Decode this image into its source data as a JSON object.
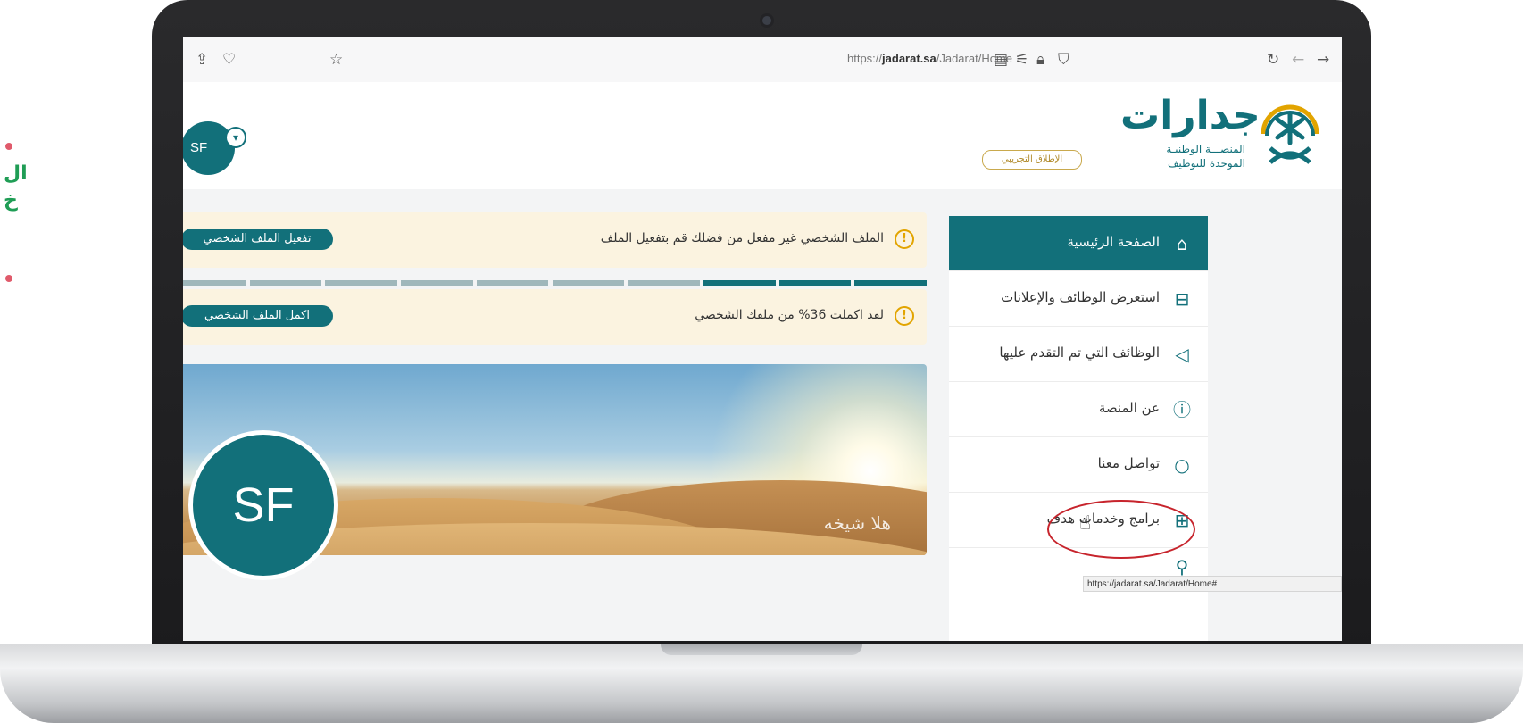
{
  "side_caption": {
    "line1": "ال",
    "line2": "خ"
  },
  "browser": {
    "url_prefix": "https://",
    "url_domain": "jadarat.sa",
    "url_path": "/Jadarat/Home"
  },
  "header": {
    "logo_title": "جدارات",
    "logo_subtitle_1": "المنصـــة الوطنيـة",
    "logo_subtitle_2": "الموحدة للتوظيف",
    "beta_label": "الإطلاق التجريبي",
    "user_initials": "SF"
  },
  "sidebar": {
    "items": [
      {
        "label": "الصفحة الرئيسية",
        "icon": "home-icon"
      },
      {
        "label": "استعرض الوظائف والإعلانات",
        "icon": "briefcase-icon"
      },
      {
        "label": "الوظائف التي تم التقدم عليها",
        "icon": "send-icon"
      },
      {
        "label": "عن المنصة",
        "icon": "info-icon"
      },
      {
        "label": "تواصل معنا",
        "icon": "chat-icon"
      },
      {
        "label": "برامج وخدمات هدف",
        "icon": "grid-icon"
      }
    ]
  },
  "status_url": "https://jadarat.sa/Jadarat/Home#",
  "alerts": {
    "activate": {
      "text": "الملف الشخصي غير مفعل من فضلك قم بتفعيل الملف",
      "button": "تفعيل الملف الشخصي"
    },
    "complete": {
      "text": "لقد اكملت 36% من ملفك الشخصي",
      "button": "اكمل الملف الشخصي"
    }
  },
  "profile_progress": {
    "completed_segments": 3,
    "total_segments": 10,
    "percent": 36
  },
  "banner": {
    "greeting": "هلا شيخه",
    "initials": "SF"
  },
  "colors": {
    "brand": "#12707a",
    "alert_bg": "#fbf3e0",
    "warning": "#e2a400",
    "highlight": "#c7242c"
  }
}
